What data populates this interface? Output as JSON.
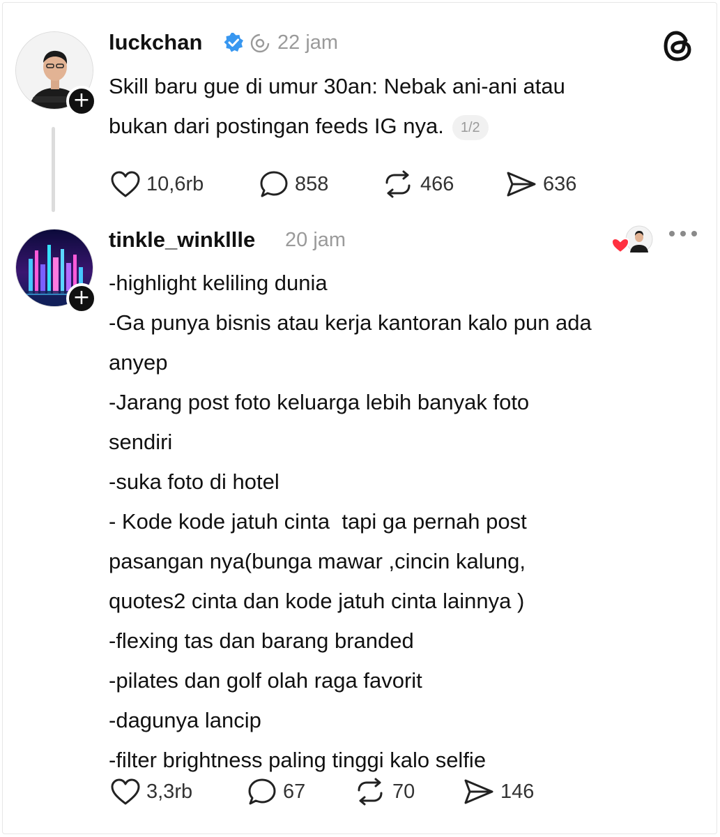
{
  "posts": [
    {
      "username": "luckchan",
      "verified": true,
      "time": "22 jam",
      "lines": [
        "Skill baru gue di umur 30an: Nebak ani-ani atau",
        "bukan dari postingan feeds IG nya."
      ],
      "page_indicator": "1/2",
      "stats": {
        "likes": "10,6rb",
        "replies": "858",
        "reposts": "466",
        "shares": "636"
      }
    },
    {
      "username": "tinkle_winkllle",
      "time": "20 jam",
      "lines": [
        "-highlight keliling dunia",
        "-Ga punya bisnis atau kerja kantoran kalo pun ada",
        "anyep",
        "-Jarang post foto keluarga lebih banyak foto",
        "sendiri",
        "-suka foto di hotel",
        "- Kode kode jatuh cinta  tapi ga pernah post",
        "pasangan nya(bunga mawar ,cincin kalung,",
        "quotes2 cinta dan kode jatuh cinta lainnya )",
        "-flexing tas dan barang branded",
        "-pilates dan golf olah raga favorit",
        "-dagunya lancip",
        "-filter brightness paling tinggi kalo selfie"
      ],
      "stats": {
        "likes": "3,3rb",
        "replies": "67",
        "reposts": "70",
        "shares": "146"
      }
    }
  ],
  "icons": {
    "verified": "verified-badge-icon",
    "threads": "threads-logo-icon",
    "like": "heart-icon",
    "reply": "comment-bubble-icon",
    "repost": "repost-icon",
    "share": "send-icon",
    "more": "more-dots-icon",
    "plus": "follow-plus-icon"
  },
  "colors": {
    "verified_blue": "#3897f0",
    "like_red": "#ff3040",
    "muted": "#9a9a9a"
  }
}
